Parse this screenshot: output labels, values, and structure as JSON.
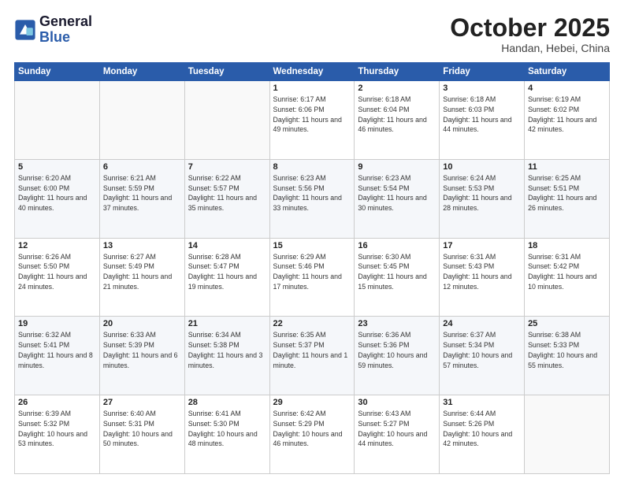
{
  "header": {
    "logo_line1": "General",
    "logo_line2": "Blue",
    "month": "October 2025",
    "location": "Handan, Hebei, China"
  },
  "days_of_week": [
    "Sunday",
    "Monday",
    "Tuesday",
    "Wednesday",
    "Thursday",
    "Friday",
    "Saturday"
  ],
  "weeks": [
    [
      {
        "day": "",
        "info": ""
      },
      {
        "day": "",
        "info": ""
      },
      {
        "day": "",
        "info": ""
      },
      {
        "day": "1",
        "info": "Sunrise: 6:17 AM\nSunset: 6:06 PM\nDaylight: 11 hours and 49 minutes."
      },
      {
        "day": "2",
        "info": "Sunrise: 6:18 AM\nSunset: 6:04 PM\nDaylight: 11 hours and 46 minutes."
      },
      {
        "day": "3",
        "info": "Sunrise: 6:18 AM\nSunset: 6:03 PM\nDaylight: 11 hours and 44 minutes."
      },
      {
        "day": "4",
        "info": "Sunrise: 6:19 AM\nSunset: 6:02 PM\nDaylight: 11 hours and 42 minutes."
      }
    ],
    [
      {
        "day": "5",
        "info": "Sunrise: 6:20 AM\nSunset: 6:00 PM\nDaylight: 11 hours and 40 minutes."
      },
      {
        "day": "6",
        "info": "Sunrise: 6:21 AM\nSunset: 5:59 PM\nDaylight: 11 hours and 37 minutes."
      },
      {
        "day": "7",
        "info": "Sunrise: 6:22 AM\nSunset: 5:57 PM\nDaylight: 11 hours and 35 minutes."
      },
      {
        "day": "8",
        "info": "Sunrise: 6:23 AM\nSunset: 5:56 PM\nDaylight: 11 hours and 33 minutes."
      },
      {
        "day": "9",
        "info": "Sunrise: 6:23 AM\nSunset: 5:54 PM\nDaylight: 11 hours and 30 minutes."
      },
      {
        "day": "10",
        "info": "Sunrise: 6:24 AM\nSunset: 5:53 PM\nDaylight: 11 hours and 28 minutes."
      },
      {
        "day": "11",
        "info": "Sunrise: 6:25 AM\nSunset: 5:51 PM\nDaylight: 11 hours and 26 minutes."
      }
    ],
    [
      {
        "day": "12",
        "info": "Sunrise: 6:26 AM\nSunset: 5:50 PM\nDaylight: 11 hours and 24 minutes."
      },
      {
        "day": "13",
        "info": "Sunrise: 6:27 AM\nSunset: 5:49 PM\nDaylight: 11 hours and 21 minutes."
      },
      {
        "day": "14",
        "info": "Sunrise: 6:28 AM\nSunset: 5:47 PM\nDaylight: 11 hours and 19 minutes."
      },
      {
        "day": "15",
        "info": "Sunrise: 6:29 AM\nSunset: 5:46 PM\nDaylight: 11 hours and 17 minutes."
      },
      {
        "day": "16",
        "info": "Sunrise: 6:30 AM\nSunset: 5:45 PM\nDaylight: 11 hours and 15 minutes."
      },
      {
        "day": "17",
        "info": "Sunrise: 6:31 AM\nSunset: 5:43 PM\nDaylight: 11 hours and 12 minutes."
      },
      {
        "day": "18",
        "info": "Sunrise: 6:31 AM\nSunset: 5:42 PM\nDaylight: 11 hours and 10 minutes."
      }
    ],
    [
      {
        "day": "19",
        "info": "Sunrise: 6:32 AM\nSunset: 5:41 PM\nDaylight: 11 hours and 8 minutes."
      },
      {
        "day": "20",
        "info": "Sunrise: 6:33 AM\nSunset: 5:39 PM\nDaylight: 11 hours and 6 minutes."
      },
      {
        "day": "21",
        "info": "Sunrise: 6:34 AM\nSunset: 5:38 PM\nDaylight: 11 hours and 3 minutes."
      },
      {
        "day": "22",
        "info": "Sunrise: 6:35 AM\nSunset: 5:37 PM\nDaylight: 11 hours and 1 minute."
      },
      {
        "day": "23",
        "info": "Sunrise: 6:36 AM\nSunset: 5:36 PM\nDaylight: 10 hours and 59 minutes."
      },
      {
        "day": "24",
        "info": "Sunrise: 6:37 AM\nSunset: 5:34 PM\nDaylight: 10 hours and 57 minutes."
      },
      {
        "day": "25",
        "info": "Sunrise: 6:38 AM\nSunset: 5:33 PM\nDaylight: 10 hours and 55 minutes."
      }
    ],
    [
      {
        "day": "26",
        "info": "Sunrise: 6:39 AM\nSunset: 5:32 PM\nDaylight: 10 hours and 53 minutes."
      },
      {
        "day": "27",
        "info": "Sunrise: 6:40 AM\nSunset: 5:31 PM\nDaylight: 10 hours and 50 minutes."
      },
      {
        "day": "28",
        "info": "Sunrise: 6:41 AM\nSunset: 5:30 PM\nDaylight: 10 hours and 48 minutes."
      },
      {
        "day": "29",
        "info": "Sunrise: 6:42 AM\nSunset: 5:29 PM\nDaylight: 10 hours and 46 minutes."
      },
      {
        "day": "30",
        "info": "Sunrise: 6:43 AM\nSunset: 5:27 PM\nDaylight: 10 hours and 44 minutes."
      },
      {
        "day": "31",
        "info": "Sunrise: 6:44 AM\nSunset: 5:26 PM\nDaylight: 10 hours and 42 minutes."
      },
      {
        "day": "",
        "info": ""
      }
    ]
  ]
}
